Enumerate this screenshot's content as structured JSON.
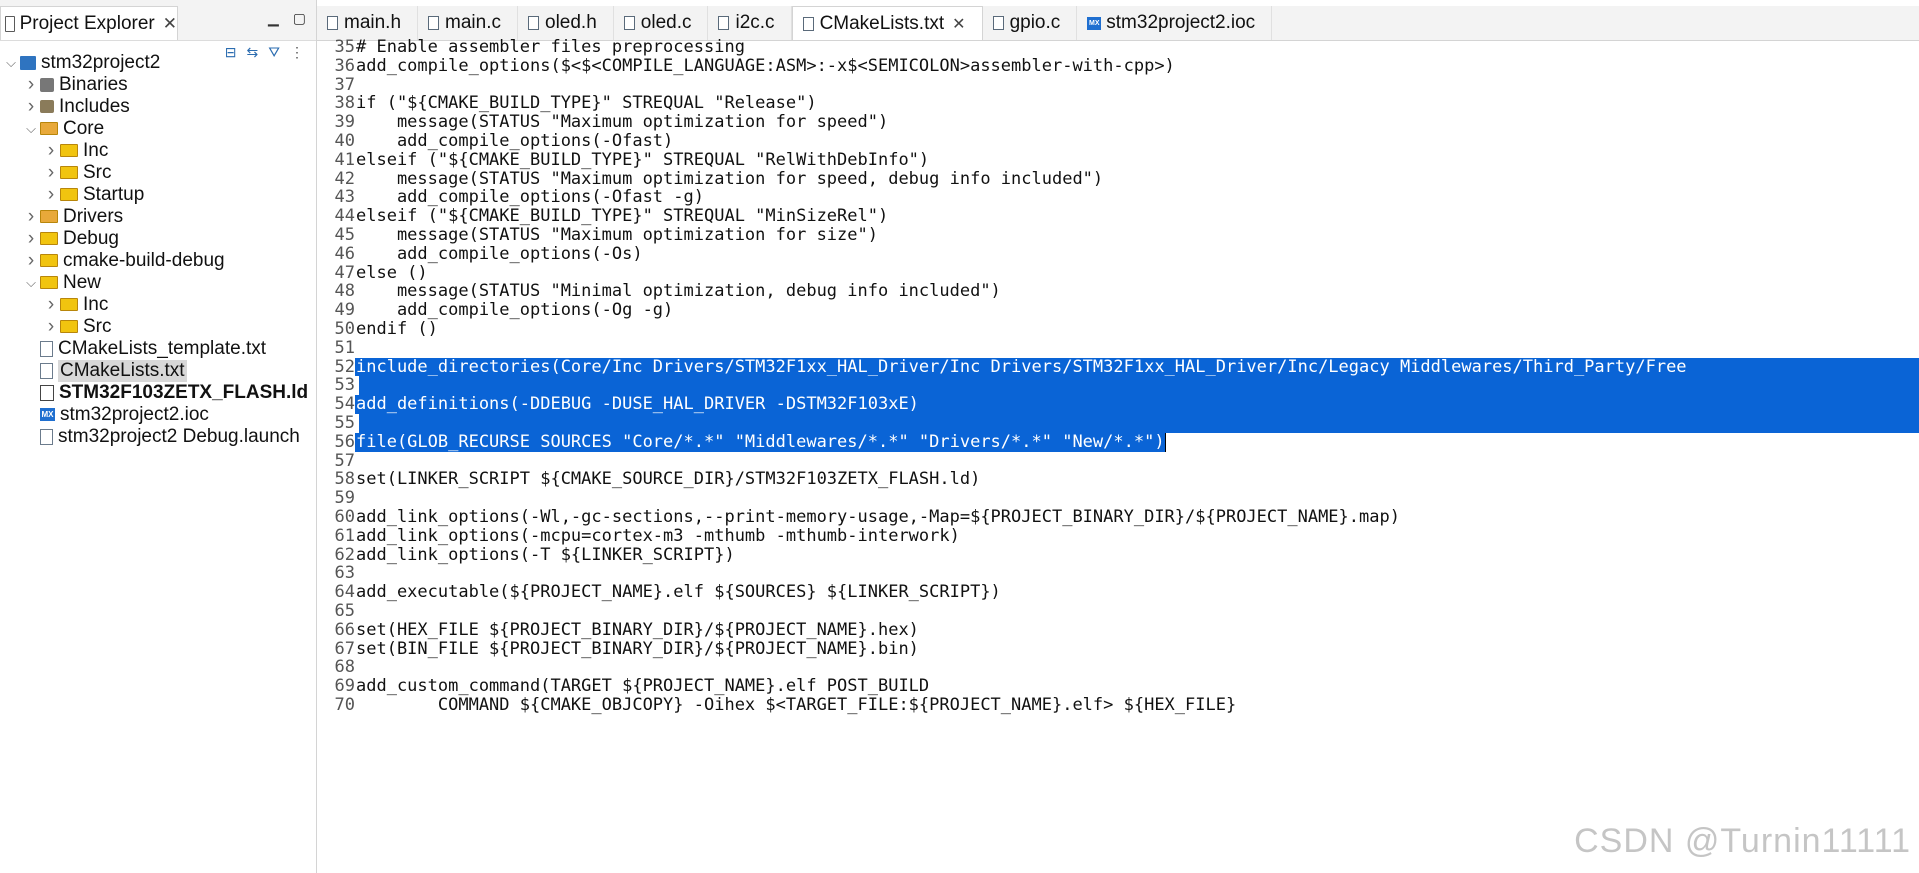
{
  "explorer": {
    "tab_label": "Project Explorer",
    "tree": [
      {
        "label": "stm32project2",
        "indent": 0,
        "twisty": "v",
        "icon": "project"
      },
      {
        "label": "Binaries",
        "indent": 1,
        "twisty": ">",
        "icon": "bin"
      },
      {
        "label": "Includes",
        "indent": 1,
        "twisty": ">",
        "icon": "inc"
      },
      {
        "label": "Core",
        "indent": 1,
        "twisty": "v",
        "icon": "folder-pkg"
      },
      {
        "label": "Inc",
        "indent": 2,
        "twisty": ">",
        "icon": "folder"
      },
      {
        "label": "Src",
        "indent": 2,
        "twisty": ">",
        "icon": "folder"
      },
      {
        "label": "Startup",
        "indent": 2,
        "twisty": ">",
        "icon": "folder"
      },
      {
        "label": "Drivers",
        "indent": 1,
        "twisty": ">",
        "icon": "folder-pkg"
      },
      {
        "label": "Debug",
        "indent": 1,
        "twisty": ">",
        "icon": "folder"
      },
      {
        "label": "cmake-build-debug",
        "indent": 1,
        "twisty": ">",
        "icon": "folder"
      },
      {
        "label": "New",
        "indent": 1,
        "twisty": "v",
        "icon": "folder"
      },
      {
        "label": "Inc",
        "indent": 2,
        "twisty": ">",
        "icon": "folder"
      },
      {
        "label": "Src",
        "indent": 2,
        "twisty": ">",
        "icon": "folder"
      },
      {
        "label": "CMakeLists_template.txt",
        "indent": 1,
        "twisty": "",
        "icon": "file"
      },
      {
        "label": "CMakeLists.txt",
        "indent": 1,
        "twisty": "",
        "icon": "file",
        "selected": true
      },
      {
        "label": "STM32F103ZETX_FLASH.ld",
        "indent": 1,
        "twisty": "",
        "icon": "ld",
        "bold": true
      },
      {
        "label": "stm32project2.ioc",
        "indent": 1,
        "twisty": "",
        "icon": "mx"
      },
      {
        "label": "stm32project2 Debug.launch",
        "indent": 1,
        "twisty": "",
        "icon": "file"
      }
    ]
  },
  "editor": {
    "tabs": [
      {
        "label": "main.h",
        "icon": "file"
      },
      {
        "label": "main.c",
        "icon": "file"
      },
      {
        "label": "oled.h",
        "icon": "file"
      },
      {
        "label": "oled.c",
        "icon": "file"
      },
      {
        "label": "i2c.c",
        "icon": "file"
      },
      {
        "label": "CMakeLists.txt",
        "icon": "file",
        "active": true
      },
      {
        "label": "gpio.c",
        "icon": "file"
      },
      {
        "label": "stm32project2.ioc",
        "icon": "mx"
      }
    ],
    "lines": [
      {
        "n": "35",
        "text": "# Enable assembler files preprocessing"
      },
      {
        "n": "36",
        "text": "add_compile_options($<$<COMPILE_LANGUAGE:ASM>:-x$<SEMICOLON>assembler-with-cpp>)"
      },
      {
        "n": "37",
        "text": ""
      },
      {
        "n": "38",
        "text": "if (\"${CMAKE_BUILD_TYPE}\" STREQUAL \"Release\")"
      },
      {
        "n": "39",
        "text": "    message(STATUS \"Maximum optimization for speed\")"
      },
      {
        "n": "40",
        "text": "    add_compile_options(-Ofast)"
      },
      {
        "n": "41",
        "text": "elseif (\"${CMAKE_BUILD_TYPE}\" STREQUAL \"RelWithDebInfo\")"
      },
      {
        "n": "42",
        "text": "    message(STATUS \"Maximum optimization for speed, debug info included\")"
      },
      {
        "n": "43",
        "text": "    add_compile_options(-Ofast -g)"
      },
      {
        "n": "44",
        "text": "elseif (\"${CMAKE_BUILD_TYPE}\" STREQUAL \"MinSizeRel\")"
      },
      {
        "n": "45",
        "text": "    message(STATUS \"Maximum optimization for size\")"
      },
      {
        "n": "46",
        "text": "    add_compile_options(-Os)"
      },
      {
        "n": "47",
        "text": "else ()"
      },
      {
        "n": "48",
        "text": "    message(STATUS \"Minimal optimization, debug info included\")"
      },
      {
        "n": "49",
        "text": "    add_compile_options(-Og -g)"
      },
      {
        "n": "50",
        "text": "endif ()"
      },
      {
        "n": "51",
        "text": ""
      },
      {
        "n": "52",
        "text": "include_directories(Core/Inc Drivers/STM32F1xx_HAL_Driver/Inc Drivers/STM32F1xx_HAL_Driver/Inc/Legacy Middlewares/Third_Party/Free",
        "sel": "full"
      },
      {
        "n": "53",
        "text": "",
        "sel": "full"
      },
      {
        "n": "54",
        "text": "add_definitions(-DDEBUG -DUSE_HAL_DRIVER -DSTM32F103xE)",
        "sel": "full"
      },
      {
        "n": "55",
        "text": "",
        "sel": "full"
      },
      {
        "n": "56",
        "text": "file(GLOB_RECURSE SOURCES \"Core/*.*\" \"Middlewares/*.*\" \"Drivers/*.*\" \"New/*.*\")",
        "sel": "partial"
      },
      {
        "n": "57",
        "text": ""
      },
      {
        "n": "58",
        "text": "set(LINKER_SCRIPT ${CMAKE_SOURCE_DIR}/STM32F103ZETX_FLASH.ld)"
      },
      {
        "n": "59",
        "text": ""
      },
      {
        "n": "60",
        "text": "add_link_options(-Wl,-gc-sections,--print-memory-usage,-Map=${PROJECT_BINARY_DIR}/${PROJECT_NAME}.map)"
      },
      {
        "n": "61",
        "text": "add_link_options(-mcpu=cortex-m3 -mthumb -mthumb-interwork)"
      },
      {
        "n": "62",
        "text": "add_link_options(-T ${LINKER_SCRIPT})"
      },
      {
        "n": "63",
        "text": ""
      },
      {
        "n": "64",
        "text": "add_executable(${PROJECT_NAME}.elf ${SOURCES} ${LINKER_SCRIPT})"
      },
      {
        "n": "65",
        "text": ""
      },
      {
        "n": "66",
        "text": "set(HEX_FILE ${PROJECT_BINARY_DIR}/${PROJECT_NAME}.hex)"
      },
      {
        "n": "67",
        "text": "set(BIN_FILE ${PROJECT_BINARY_DIR}/${PROJECT_NAME}.bin)"
      },
      {
        "n": "68",
        "text": ""
      },
      {
        "n": "69",
        "text": "add_custom_command(TARGET ${PROJECT_NAME}.elf POST_BUILD"
      },
      {
        "n": "70",
        "text": "        COMMAND ${CMAKE_OBJCOPY} -Oihex $<TARGET_FILE:${PROJECT_NAME}.elf> ${HEX_FILE}"
      }
    ]
  },
  "watermark": "CSDN @Turnin11111",
  "colors": {
    "selection": "#0a64d6",
    "selection_text": "#ffffff"
  }
}
